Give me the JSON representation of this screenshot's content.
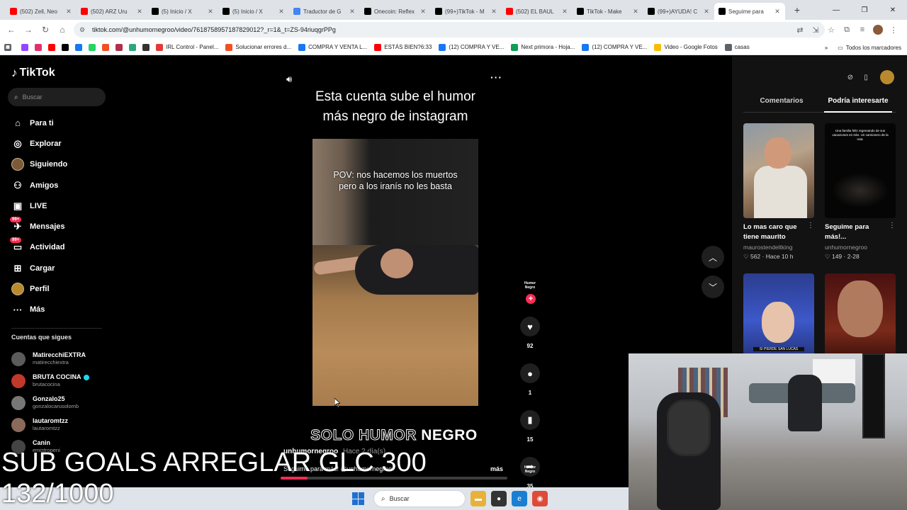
{
  "browser": {
    "tabs": [
      {
        "title": "(502) Zell, Neo",
        "icon": "youtube-icon",
        "color": "#ff0000"
      },
      {
        "title": "(502) ARZ Uru",
        "icon": "youtube-icon",
        "color": "#ff0000"
      },
      {
        "title": "(5) Inicio / X",
        "icon": "x-icon",
        "color": "#000000"
      },
      {
        "title": "(5) Inicio / X",
        "icon": "x-icon",
        "color": "#000000"
      },
      {
        "title": "Traductor de G",
        "icon": "translate-icon",
        "color": "#4285f4"
      },
      {
        "title": "Onecoin: Reflex",
        "icon": "tiktok-icon",
        "color": "#000000"
      },
      {
        "title": "(99+)TikTok - M",
        "icon": "tiktok-icon",
        "color": "#000000"
      },
      {
        "title": "(502) EL BAUL",
        "icon": "youtube-icon",
        "color": "#ff0000"
      },
      {
        "title": "TikTok - Make",
        "icon": "tiktok-icon",
        "color": "#000000"
      },
      {
        "title": "(99+)AYUDA! C",
        "icon": "tiktok-icon",
        "color": "#000000"
      },
      {
        "title": "Seguime para",
        "icon": "tiktok-icon",
        "color": "#000000",
        "active": true
      }
    ],
    "url": "tiktok.com/@unhumornegroo/video/7618758957187829012?_r=1&_t=ZS-94riuqgrPPg",
    "bookmarks": [
      {
        "label": "",
        "icon": "twitch-icon",
        "color": "#9146ff"
      },
      {
        "label": "",
        "icon": "instagram-icon",
        "color": "#e1306c"
      },
      {
        "label": "",
        "icon": "youtube-icon",
        "color": "#ff0000"
      },
      {
        "label": "",
        "icon": "x-icon",
        "color": "#000000"
      },
      {
        "label": "",
        "icon": "facebook-icon",
        "color": "#1877f2"
      },
      {
        "label": "",
        "icon": "whatsapp-icon",
        "color": "#25d366"
      },
      {
        "label": "",
        "icon": "microsoft-icon",
        "color": "#f25022"
      },
      {
        "label": "",
        "icon": "app-icon",
        "color": "#b0304a"
      },
      {
        "label": "",
        "icon": "app-icon-2",
        "color": "#2aa87a"
      },
      {
        "label": "",
        "icon": "app-icon-3",
        "color": "#333333"
      },
      {
        "label": "IRL Control - Panel...",
        "icon": "irl-icon",
        "color": "#e53935"
      },
      {
        "label": "Solucionar errores d...",
        "icon": "windows-icon",
        "color": "#f25022"
      },
      {
        "label": "COMPRA Y VENTA L...",
        "icon": "facebook-icon",
        "color": "#1877f2"
      },
      {
        "label": "ESTÁS BIEN?6:33",
        "icon": "youtube-icon",
        "color": "#ff0000"
      },
      {
        "label": "(12) COMPRA Y VE...",
        "icon": "facebook-icon",
        "color": "#1877f2"
      },
      {
        "label": "Next primora - Hoja...",
        "icon": "sheets-icon",
        "color": "#0f9d58"
      },
      {
        "label": "(12) COMPRA Y VE...",
        "icon": "facebook-icon",
        "color": "#1877f2"
      },
      {
        "label": "Video - Google Fotos",
        "icon": "photos-icon",
        "color": "#fbbc04"
      },
      {
        "label": "casas",
        "icon": "folder-icon",
        "color": "#5f6368"
      }
    ],
    "all_bookmarks": "Todos los marcadores"
  },
  "tiktok": {
    "logo": "TikTok",
    "search_placeholder": "Buscar",
    "menu": [
      {
        "label": "Para ti",
        "icon": "home-icon",
        "glyph": "⌂"
      },
      {
        "label": "Explorar",
        "icon": "compass-icon",
        "glyph": "◎"
      },
      {
        "label": "Siguiendo",
        "icon": "following-avatar-icon",
        "glyph": ""
      },
      {
        "label": "Amigos",
        "icon": "friends-icon",
        "glyph": "⚇"
      },
      {
        "label": "LIVE",
        "icon": "live-icon",
        "glyph": "▣"
      },
      {
        "label": "Mensajes",
        "icon": "messages-icon",
        "glyph": "✈",
        "badge": "99+"
      },
      {
        "label": "Actividad",
        "icon": "activity-icon",
        "glyph": "▭",
        "badge": "99+"
      },
      {
        "label": "Cargar",
        "icon": "upload-icon",
        "glyph": "⊞"
      },
      {
        "label": "Perfil",
        "icon": "profile-avatar-icon",
        "glyph": ""
      },
      {
        "label": "Más",
        "icon": "more-icon",
        "glyph": "···"
      }
    ],
    "following_title": "Cuentas que sigues",
    "following": [
      {
        "name": "MatirecchiEXTRA",
        "user": "matirecchiextra",
        "color": "#5b5b5b",
        "verified": false
      },
      {
        "name": "BRUTA COCINA",
        "user": "brutacocina",
        "color": "#c0392b",
        "verified": true
      },
      {
        "name": "Gonzalo25",
        "user": "gonzalocarusolomb",
        "color": "#777777",
        "verified": false
      },
      {
        "name": "lautaromtzz",
        "user": "lautaromtzz",
        "color": "#8a6a5a",
        "verified": false
      },
      {
        "name": "Canin",
        "user": "emistropeni",
        "color": "#444444",
        "verified": false
      }
    ],
    "video": {
      "title_line1": "Esta cuenta sube el humor",
      "title_line2": "más negro de instagram",
      "caption": "POV: nos hacemos los muertos pero a los iranís no les basta",
      "brand_left": "SOLO HUMOR",
      "brand_right": "NEGRO",
      "author": "unhumornegroo",
      "date": "Hace 2 día(s)",
      "description": "Seguime para más! @unhumornegroo",
      "more_label": "más",
      "progress": 0.12,
      "avatar_text": "Humor Negro",
      "likes": "92",
      "comments": "1",
      "saves": "15",
      "shares": "35"
    },
    "panel": {
      "tab_comments": "Comentarios",
      "tab_suggested": "Podría interesarte",
      "cards": [
        {
          "title": "Lo mas caro que tiene maurito",
          "user": "maurostendeltking",
          "stats": "♡ 562 · Hace 10 h"
        },
        {
          "title": "Seguime para más!...",
          "user": "unhumornegroo",
          "stats": "♡ 149 · 2-28"
        },
        {
          "title": "",
          "user": "",
          "stats": ""
        },
        {
          "title": "",
          "user": "",
          "stats": ""
        }
      ],
      "card2_text": "Una familia feliz regresando de sus vacaciones en Irán. Un camionero de la ruta:",
      "card3_label": "SI PIERDE SAN LUCAS"
    }
  },
  "overlay": {
    "line1": "SUB GOALS ARREGLAR GLC  300",
    "line2": "132/1000"
  },
  "taskbar": {
    "search": "Buscar"
  }
}
